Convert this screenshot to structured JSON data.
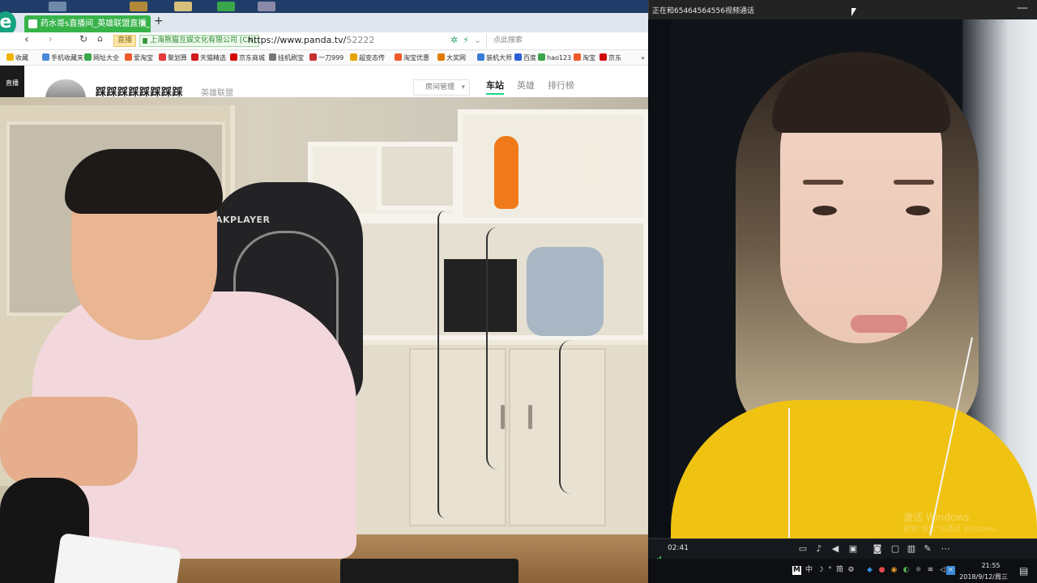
{
  "browser": {
    "tab": {
      "title": "药水哥s直播间_英雄联盟直播_le"
    },
    "nav": {
      "back": "‹",
      "refresh": "↻",
      "home_icon": "home"
    },
    "address": {
      "badge": "直播",
      "cert_label": "上海熊猫互娱文化有限公司 [CN]",
      "url_host": "https://www.panda.tv/",
      "url_path": "52222",
      "search_placeholder": "点此搜索"
    },
    "bookmarks": [
      {
        "label": "收藏",
        "color": "#f1b400"
      },
      {
        "label": "手机收藏夹",
        "color": "#4a8ad8"
      },
      {
        "label": "网址大全",
        "color": "#3aa64a"
      },
      {
        "label": "爱淘宝",
        "color": "#f05a28"
      },
      {
        "label": "聚划算",
        "color": "#e43a3a"
      },
      {
        "label": "天猫精选",
        "color": "#d41a1a"
      },
      {
        "label": "京东商城",
        "color": "#d10b0b"
      },
      {
        "label": "挂机刷宝",
        "color": "#777777"
      },
      {
        "label": "一刀999",
        "color": "#c43030"
      },
      {
        "label": "超变态传",
        "color": "#e8a300"
      },
      {
        "label": "淘宝优惠",
        "color": "#f05a28"
      },
      {
        "label": "大奖网",
        "color": "#e07b00"
      },
      {
        "label": "装机大师",
        "color": "#3a7ad8"
      },
      {
        "label": "百度",
        "color": "#2f5fd8"
      },
      {
        "label": "hao123",
        "color": "#3aa64a"
      },
      {
        "label": "淘宝",
        "color": "#f05a28"
      },
      {
        "label": "京东",
        "color": "#d10b0b"
      }
    ],
    "bookmarks_more": "»",
    "page": {
      "logo_text": "直播",
      "room_title": "踩踩踩踩踩踩踩踩",
      "room_category": "英雄联盟",
      "room_manage": "房间管理",
      "tabs": [
        "车站",
        "英雄",
        "排行榜"
      ],
      "active_tab": "车站"
    },
    "chair_brand": "AKPLAYER"
  },
  "call": {
    "title": "正在和65464564556视频通话",
    "minimize": "—",
    "duration": "02:41",
    "watermark_line1": "激活 Windows",
    "watermark_line2": "转到\"设置\"以激活 Windows。"
  },
  "taskbar": {
    "ime_items": [
      "M",
      "中",
      "☽",
      "°",
      "简",
      "⚙"
    ],
    "time": "21:55",
    "date": "2018/9/12/周三",
    "accent": "#1cd388"
  }
}
